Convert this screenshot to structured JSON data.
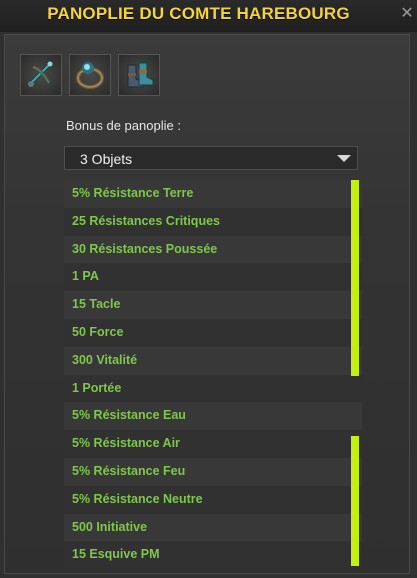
{
  "window": {
    "title": "PANOPLIE DU COMTE HAREBOURG"
  },
  "items": [
    {
      "icon": "crossbow-icon"
    },
    {
      "icon": "ring-icon"
    },
    {
      "icon": "boots-icon"
    }
  ],
  "bonus": {
    "label": "Bonus de panoplie :",
    "selected": "3 Objets",
    "rows": [
      "5% Résistance Terre",
      "25 Résistances Critiques",
      "30 Résistances Poussée",
      "1 PA",
      "15 Tacle",
      "50 Force",
      "300 Vitalité",
      "1 Portée",
      "5% Résistance Eau",
      "5% Résistance Air",
      "5% Résistance Feu",
      "5% Résistance Neutre",
      "500 Initiative",
      "15 Esquive PM"
    ]
  },
  "colors": {
    "title": "#f5d33a",
    "bonus_text": "#7fc74a",
    "scrollbar": "#c3ef12"
  }
}
